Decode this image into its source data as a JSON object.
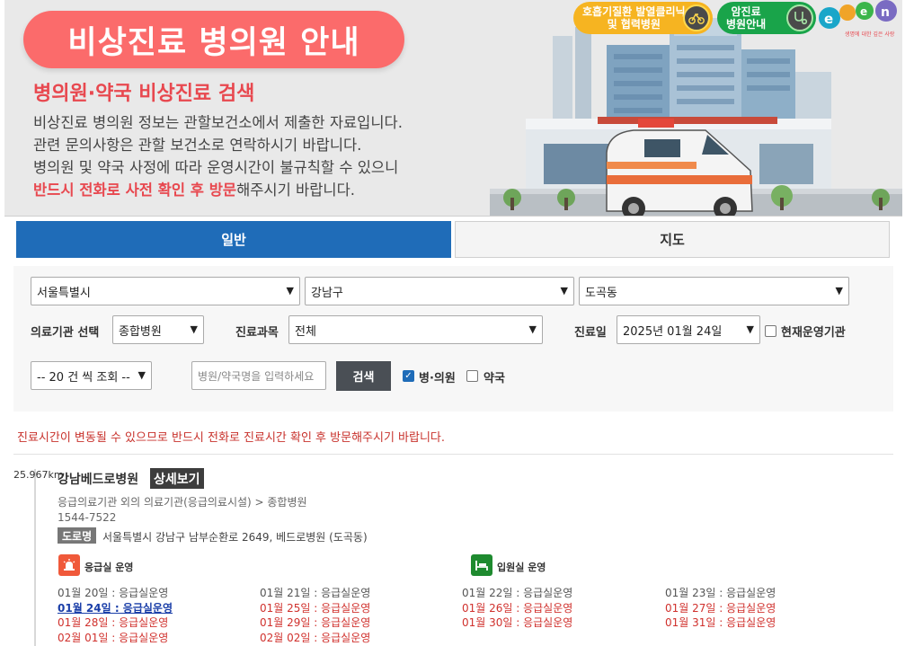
{
  "banner": {
    "title": "비상진료 병의원 안내",
    "subtitle": "병의원·약국 비상진료 검색",
    "desc_line1": "비상진료 병의원 정보는 관할보건소에서 제출한 자료입니다.",
    "desc_line2": "관련 문의사항은 관할 보건소로 연락하시기 바랍니다.",
    "desc_line3": "병의원 및 약국 사정에 따라 운영시간이 불규칙할 수 있으니",
    "desc_line4_red": "반드시 전화로 사전 확인 후 방문",
    "desc_line4_rest": "해주시기 바랍니다.",
    "badge1_line1": "호흡기질환 발열클리닉",
    "badge1_line2": "및 협력병원",
    "badge2_line1": "암진료",
    "badge2_line2": "병원안내",
    "logo_text": "e-gen",
    "logo_tag": "생명에 대한 깊은 사랑"
  },
  "tabs": {
    "general": "일반",
    "map": "지도"
  },
  "search": {
    "sido": "서울특별시",
    "sigungu": "강남구",
    "dong": "도곡동",
    "org_label": "의료기관 선택",
    "org_value": "종합병원",
    "dept_label": "진료과목",
    "dept_value": "전체",
    "date_label": "진료일",
    "date_value": "2025년 01월 24일",
    "now_open_label": "현재운영기관",
    "now_open_checked": false,
    "page_size": "-- 20 건 씩 조회 --",
    "keyword_placeholder": "병원/약국명을 입력하세요",
    "search_button": "검색",
    "hospital_label": "병·의원",
    "hospital_checked": true,
    "pharmacy_label": "약국",
    "pharmacy_checked": false
  },
  "notice": "진료시간이 변동될 수 있으므로 반드시 전화로 진료시간 확인 후 방문해주시기 바랍니다.",
  "result": {
    "distance": "25.967km",
    "name": "강남베드로병원",
    "detail_button": "상세보기",
    "category": "응급의료기관 외의 의료기관(응급의료시설) > 종합병원",
    "phone": "1544-7522",
    "road_tag": "도로명",
    "address": "서울특별시 강남구 남부순환로 2649, 베드로병원 (도곡동)",
    "er_label": "응급실 운영",
    "ward_label": "입원실 운영",
    "colors": {
      "er_icon": "#f0593a",
      "ward_icon": "#1e8a2f"
    },
    "days": [
      {
        "text": "01월 20일 : 응급실운영",
        "style": "k"
      },
      {
        "text": "01월 21일 : 응급실운영",
        "style": "k"
      },
      {
        "text": "01월 22일 : 응급실운영",
        "style": "k"
      },
      {
        "text": "01월 23일 : 응급실운영",
        "style": "k"
      },
      {
        "text": "01월 24일 : 응급실운영",
        "style": "today"
      },
      {
        "text": "01월 25일 : 응급실운영",
        "style": "r"
      },
      {
        "text": "01월 26일 : 응급실운영",
        "style": "r"
      },
      {
        "text": "01월 27일 : 응급실운영",
        "style": "r"
      },
      {
        "text": "01월 28일 : 응급실운영",
        "style": "r"
      },
      {
        "text": "01월 29일 : 응급실운영",
        "style": "r"
      },
      {
        "text": "01월 30일 : 응급실운영",
        "style": "r"
      },
      {
        "text": "01월 31일 : 응급실운영",
        "style": "r"
      },
      {
        "text": "02월 01일 : 응급실운영",
        "style": "r"
      },
      {
        "text": "02월 02일 : 응급실운영",
        "style": "r"
      }
    ]
  }
}
